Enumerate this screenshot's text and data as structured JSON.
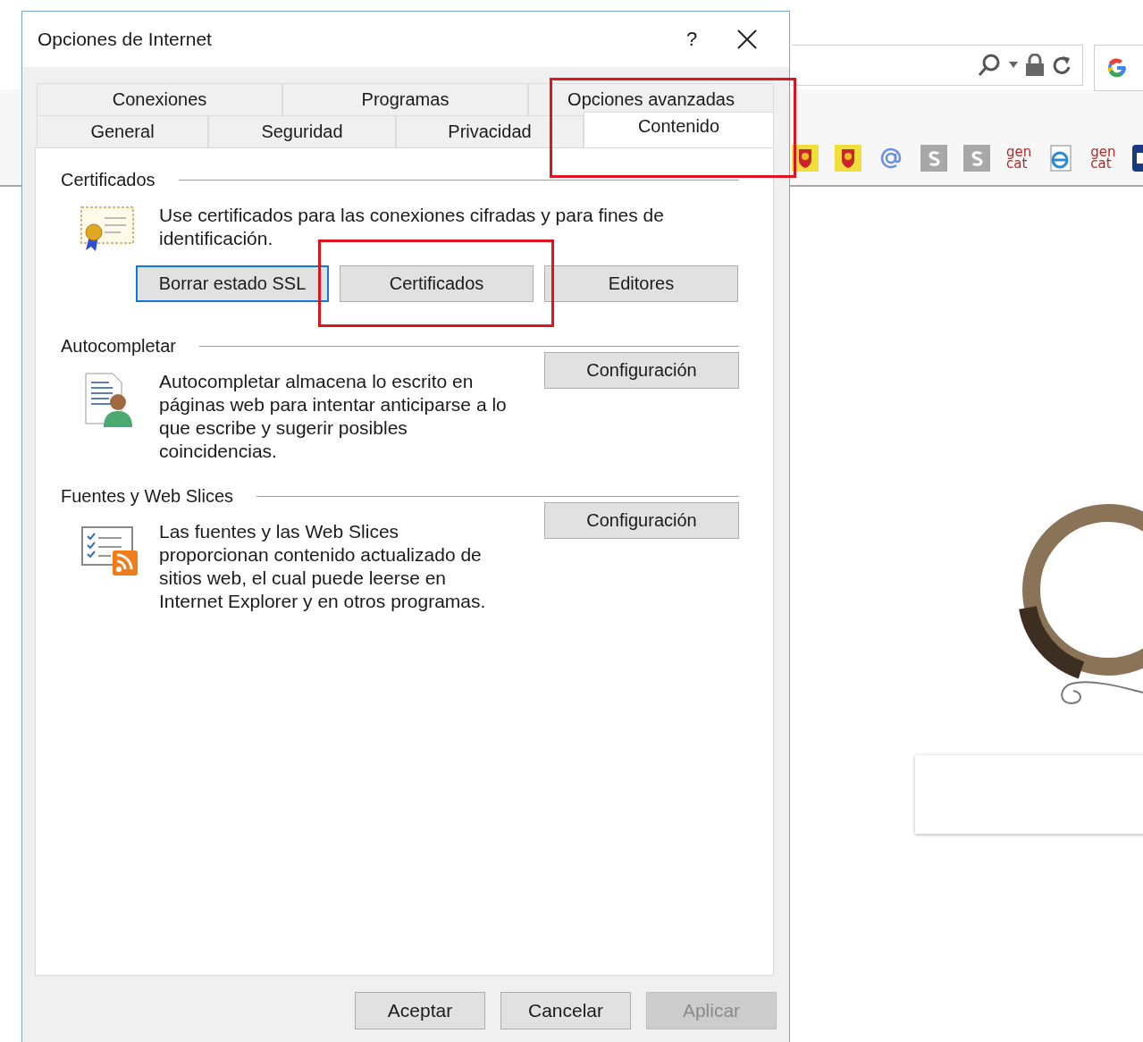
{
  "browser": {
    "favorites": [
      {
        "kind": "crest"
      },
      {
        "kind": "crest"
      },
      {
        "kind": "at"
      },
      {
        "kind": "s"
      },
      {
        "kind": "s"
      },
      {
        "kind": "text",
        "label": "gen\ncat"
      },
      {
        "kind": "ie"
      },
      {
        "kind": "text",
        "label": "gen\ncat"
      },
      {
        "kind": "partial"
      }
    ]
  },
  "dialog": {
    "title": "Opciones de Internet",
    "help": "?",
    "tab_rows": [
      [
        {
          "label": "Conexiones",
          "selected": false,
          "highlighted": false
        },
        {
          "label": "Programas",
          "selected": false,
          "highlighted": false
        },
        {
          "label": "Opciones avanzadas",
          "selected": false,
          "highlighted": false
        }
      ],
      [
        {
          "label": "General",
          "selected": false,
          "highlighted": false
        },
        {
          "label": "Seguridad",
          "selected": false,
          "highlighted": false
        },
        {
          "label": "Privacidad",
          "selected": false,
          "highlighted": false
        },
        {
          "label": "Contenido",
          "selected": true,
          "highlighted": true
        }
      ]
    ],
    "sections": [
      {
        "title": "Certificados",
        "text": "Use certificados para las conexiones cifradas y para fines de identificación.",
        "buttons": [
          {
            "label": "Borrar estado SSL",
            "focused": true,
            "highlighted": false
          },
          {
            "label": "Certificados",
            "focused": false,
            "highlighted": true
          },
          {
            "label": "Editores",
            "focused": false,
            "highlighted": false
          }
        ]
      },
      {
        "title": "Autocompletar",
        "text": "Autocompletar almacena lo escrito en páginas web para intentar anticiparse a lo que escribe y sugerir posibles coincidencias.",
        "buttons": [
          {
            "label": "Configuración",
            "focused": false,
            "highlighted": false
          }
        ]
      },
      {
        "title": "Fuentes y Web Slices",
        "text": "Las fuentes y las Web Slices proporcionan contenido actualizado de sitios web, el cual puede leerse en Internet Explorer y en otros programas.",
        "buttons": [
          {
            "label": "Configuración",
            "focused": false,
            "highlighted": false
          }
        ]
      }
    ],
    "footer_buttons": [
      {
        "label": "Aceptar",
        "disabled": false
      },
      {
        "label": "Cancelar",
        "disabled": false
      },
      {
        "label": "Aplicar",
        "disabled": true
      }
    ]
  }
}
